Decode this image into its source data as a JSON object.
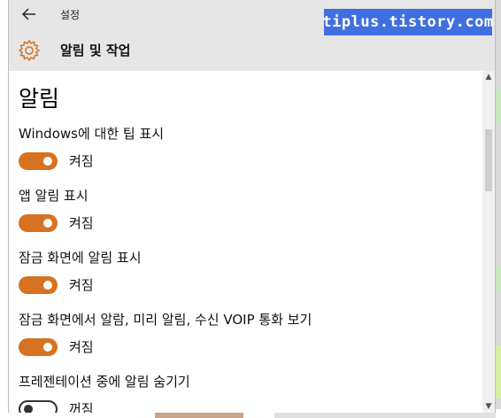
{
  "titlebar": {
    "title": "설정"
  },
  "header": {
    "title": "알림 및 작업"
  },
  "watermark": {
    "text": "tiplus.tistory.com"
  },
  "section": {
    "title": "알림"
  },
  "settings": [
    {
      "label": "Windows에 대한 팁 표시",
      "state": "켜짐",
      "on": true
    },
    {
      "label": "앱 알림 표시",
      "state": "켜짐",
      "on": true
    },
    {
      "label": "잠금 화면에 알림 표시",
      "state": "켜짐",
      "on": true
    },
    {
      "label": "잠금 화면에서 알람, 미리 알림, 수신 VOIP 통화 보기",
      "state": "켜짐",
      "on": true
    },
    {
      "label": "프레젠테이션 중에 알림 숨기기",
      "state": "꺼짐",
      "on": false
    }
  ],
  "colors": {
    "accent": "#d67220",
    "titlebar_bg": "#e6e6e6",
    "watermark_bg": "#3f6fe0"
  },
  "icons": {
    "back": "back-arrow-icon",
    "gear": "gear-icon",
    "minimize": "minimize-icon",
    "maximize": "maximize-icon",
    "close": "close-icon",
    "scroll_up": "chevron-up-icon",
    "scroll_down": "chevron-down-icon"
  }
}
